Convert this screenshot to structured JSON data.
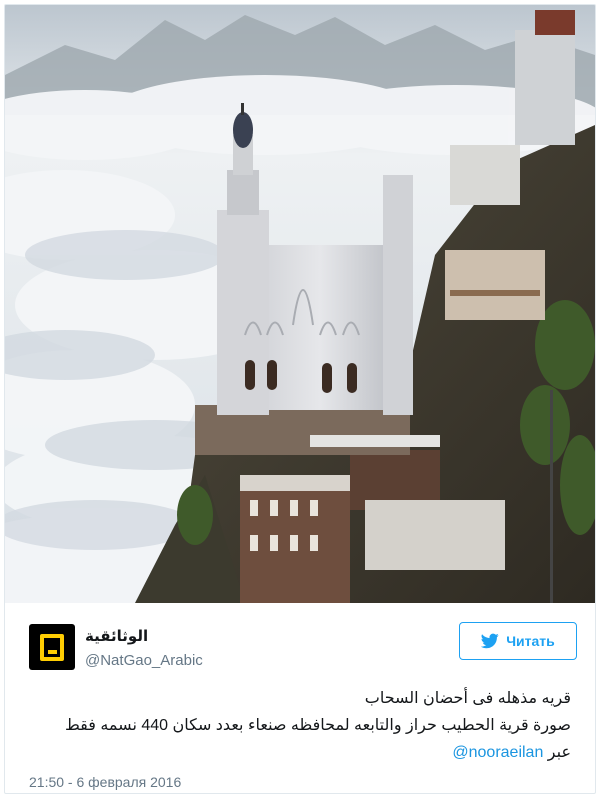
{
  "tweet": {
    "author_name": "الوثائقية",
    "author_handle": "@NatGao_Arabic",
    "follow_label": "Читать",
    "text_line1": "قريه مذهله فى أحضان السحاب",
    "text_line2": "صورة قرية الحطيب حراز والتابعه لمحافظه صنعاء بعدد سكان 440 نسمه فقط",
    "via_label": "عبر",
    "mention": "@nooraeilan",
    "timestamp": "21:50 - 6 февраля 2016"
  },
  "photo": {
    "subject": "village-on-cliff-above-clouds"
  },
  "colors": {
    "link": "#1b95e0",
    "follow_border": "#1da1f2",
    "muted": "#657786",
    "avatar_accent": "#ffcd02"
  },
  "icons": {
    "follow": "twitter-bird-icon",
    "avatar": "natgeo-frame-logo"
  }
}
